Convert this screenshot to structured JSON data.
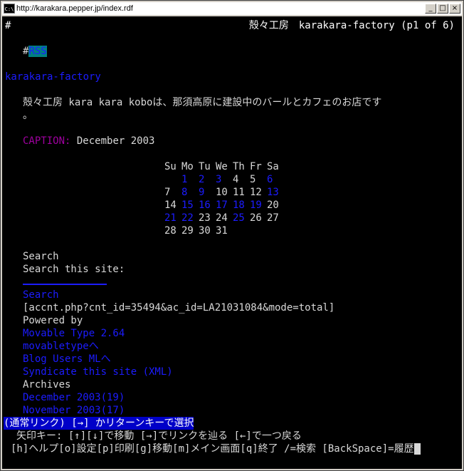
{
  "window": {
    "title": "http://karakara.pepper.jp/index.rdf",
    "minimize": "_",
    "maximize": "□",
    "close": "×"
  },
  "header": {
    "left": "#",
    "right": "殻々工房　karakara-factory (p1 of 6)"
  },
  "rss": {
    "prefix": "#",
    "label": "RSS"
  },
  "site_title": "karakara-factory",
  "description": {
    "line1": "殻々工房 kara kara koboは、那須高原に建設中のバールとカフェのお店です",
    "line2": "。"
  },
  "calendar": {
    "caption_label": "CAPTION:",
    "caption_value": " December 2003",
    "weekdays": [
      "Su",
      "Mo",
      "Tu",
      "We",
      "Th",
      "Fr",
      "Sa"
    ],
    "weeks": [
      [
        {
          "d": "",
          "link": false
        },
        {
          "d": "1",
          "link": true
        },
        {
          "d": "2",
          "link": true
        },
        {
          "d": "3",
          "link": true
        },
        {
          "d": "4",
          "link": false
        },
        {
          "d": "5",
          "link": false
        },
        {
          "d": "6",
          "link": true
        }
      ],
      [
        {
          "d": "7",
          "link": false
        },
        {
          "d": "8",
          "link": true
        },
        {
          "d": "9",
          "link": true
        },
        {
          "d": "10",
          "link": false
        },
        {
          "d": "11",
          "link": false
        },
        {
          "d": "12",
          "link": false
        },
        {
          "d": "13",
          "link": true
        }
      ],
      [
        {
          "d": "14",
          "link": false
        },
        {
          "d": "15",
          "link": true
        },
        {
          "d": "16",
          "link": true
        },
        {
          "d": "17",
          "link": true
        },
        {
          "d": "18",
          "link": true
        },
        {
          "d": "19",
          "link": true
        },
        {
          "d": "20",
          "link": false
        }
      ],
      [
        {
          "d": "21",
          "link": true
        },
        {
          "d": "22",
          "link": true
        },
        {
          "d": "23",
          "link": false
        },
        {
          "d": "24",
          "link": false
        },
        {
          "d": "25",
          "link": true
        },
        {
          "d": "26",
          "link": false
        },
        {
          "d": "27",
          "link": false
        }
      ],
      [
        {
          "d": "28",
          "link": false
        },
        {
          "d": "29",
          "link": false
        },
        {
          "d": "30",
          "link": false
        },
        {
          "d": "31",
          "link": false
        },
        {
          "d": "",
          "link": false
        },
        {
          "d": "",
          "link": false
        },
        {
          "d": "",
          "link": false
        }
      ]
    ]
  },
  "sidebar": {
    "search_heading": "Search",
    "search_prompt": "Search this site:",
    "search_button": "Search",
    "counter_link": "[accnt.php?cnt_id=35494&ac_id=LA21031084&mode=total]",
    "powered_by": "Powered by",
    "movable_type": "Movable Type 2.64",
    "movabletype_link": "movabletypeへ",
    "blog_users": "Blog Users MLへ",
    "syndicate": "Syndicate this site (XML)",
    "archives_heading": "Archives",
    "archive_dec": "December 2003(19)",
    "archive_nov": "November 2003(17)"
  },
  "status": {
    "selection": "(通常リンク) [→] かリターンキーで選択",
    "help1": "矢印キー: [↑][↓]で移動 [→]でリンクを辿る [←]で一つ戻る",
    "help2": "[h]ヘルプ[o]設定[p]印刷[g]移動[m]メイン画面[q]終了 /=検索 [BackSpace]=履歴"
  }
}
